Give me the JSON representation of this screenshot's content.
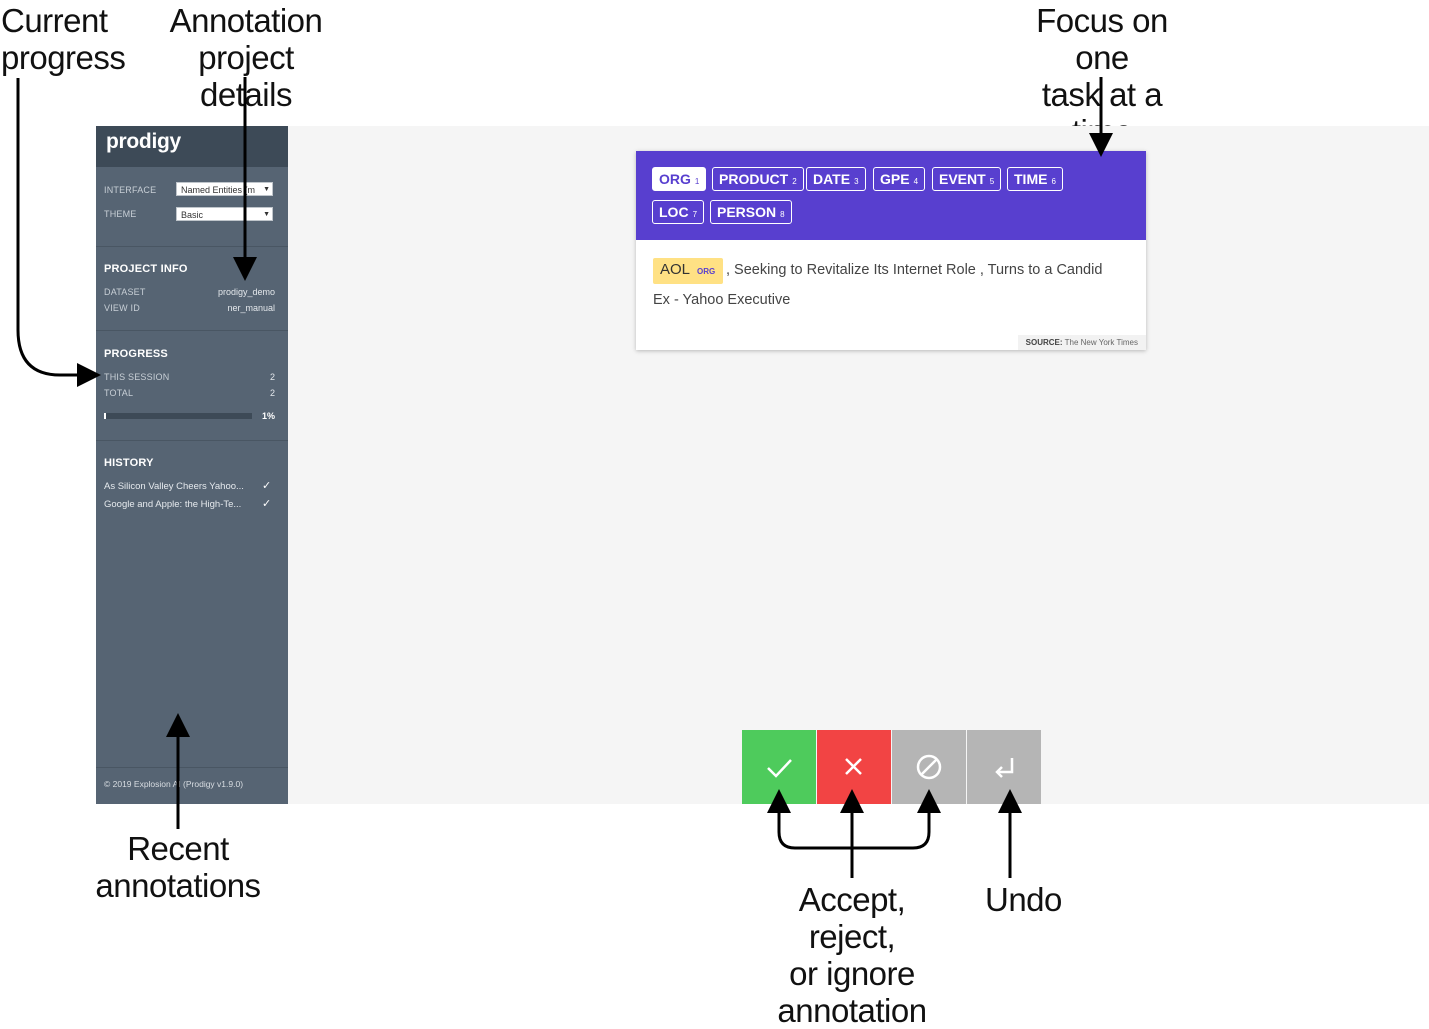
{
  "callouts": {
    "current_progress": [
      "Current",
      "progress"
    ],
    "project_details": [
      "Annotation",
      "project details"
    ],
    "focus": [
      "Focus on one",
      "task at a time"
    ],
    "recent": [
      "Recent",
      "annotations"
    ],
    "accept": [
      "Accept, reject,",
      "or ignore",
      "annotation"
    ],
    "undo": "Undo"
  },
  "sidebar": {
    "logo": "prodigy",
    "interface_label": "INTERFACE",
    "interface_value": "Named Entities (m",
    "theme_label": "THEME",
    "theme_value": "Basic",
    "project_info_title": "PROJECT INFO",
    "dataset_label": "DATASET",
    "dataset_value": "prodigy_demo",
    "view_id_label": "VIEW ID",
    "view_id_value": "ner_manual",
    "progress_title": "PROGRESS",
    "this_session_label": "THIS SESSION",
    "this_session_value": "2",
    "total_label": "TOTAL",
    "total_value": "2",
    "progress_percent": "1%",
    "progress_fraction": 0.01,
    "history_title": "HISTORY",
    "history": [
      "As Silicon Valley Cheers Yahoo...",
      "Google and Apple: the High-Te..."
    ],
    "footer": "© 2019 Explosion AI    (Prodigy v1.9.0)"
  },
  "card": {
    "labels": [
      {
        "name": "ORG",
        "key": "1"
      },
      {
        "name": "PRODUCT",
        "key": "2"
      },
      {
        "name": "DATE",
        "key": "3"
      },
      {
        "name": "GPE",
        "key": "4"
      },
      {
        "name": "EVENT",
        "key": "5"
      },
      {
        "name": "TIME",
        "key": "6"
      },
      {
        "name": "LOC",
        "key": "7"
      },
      {
        "name": "PERSON",
        "key": "8"
      }
    ],
    "entity_text": "AOL",
    "entity_label": "ORG",
    "text_line1": ", Seeking to Revitalize Its Internet Role , Turns to a Candid",
    "text_line2": "Ex - Yahoo Executive",
    "source_label": "SOURCE:",
    "source_value": "The New York Times"
  },
  "colors": {
    "accept": "#4ecb5c",
    "reject": "#f24444",
    "ignore": "#b5b5b5",
    "undo": "#b5b5b5",
    "header": "#583fcf",
    "sidebar": "#566473"
  }
}
